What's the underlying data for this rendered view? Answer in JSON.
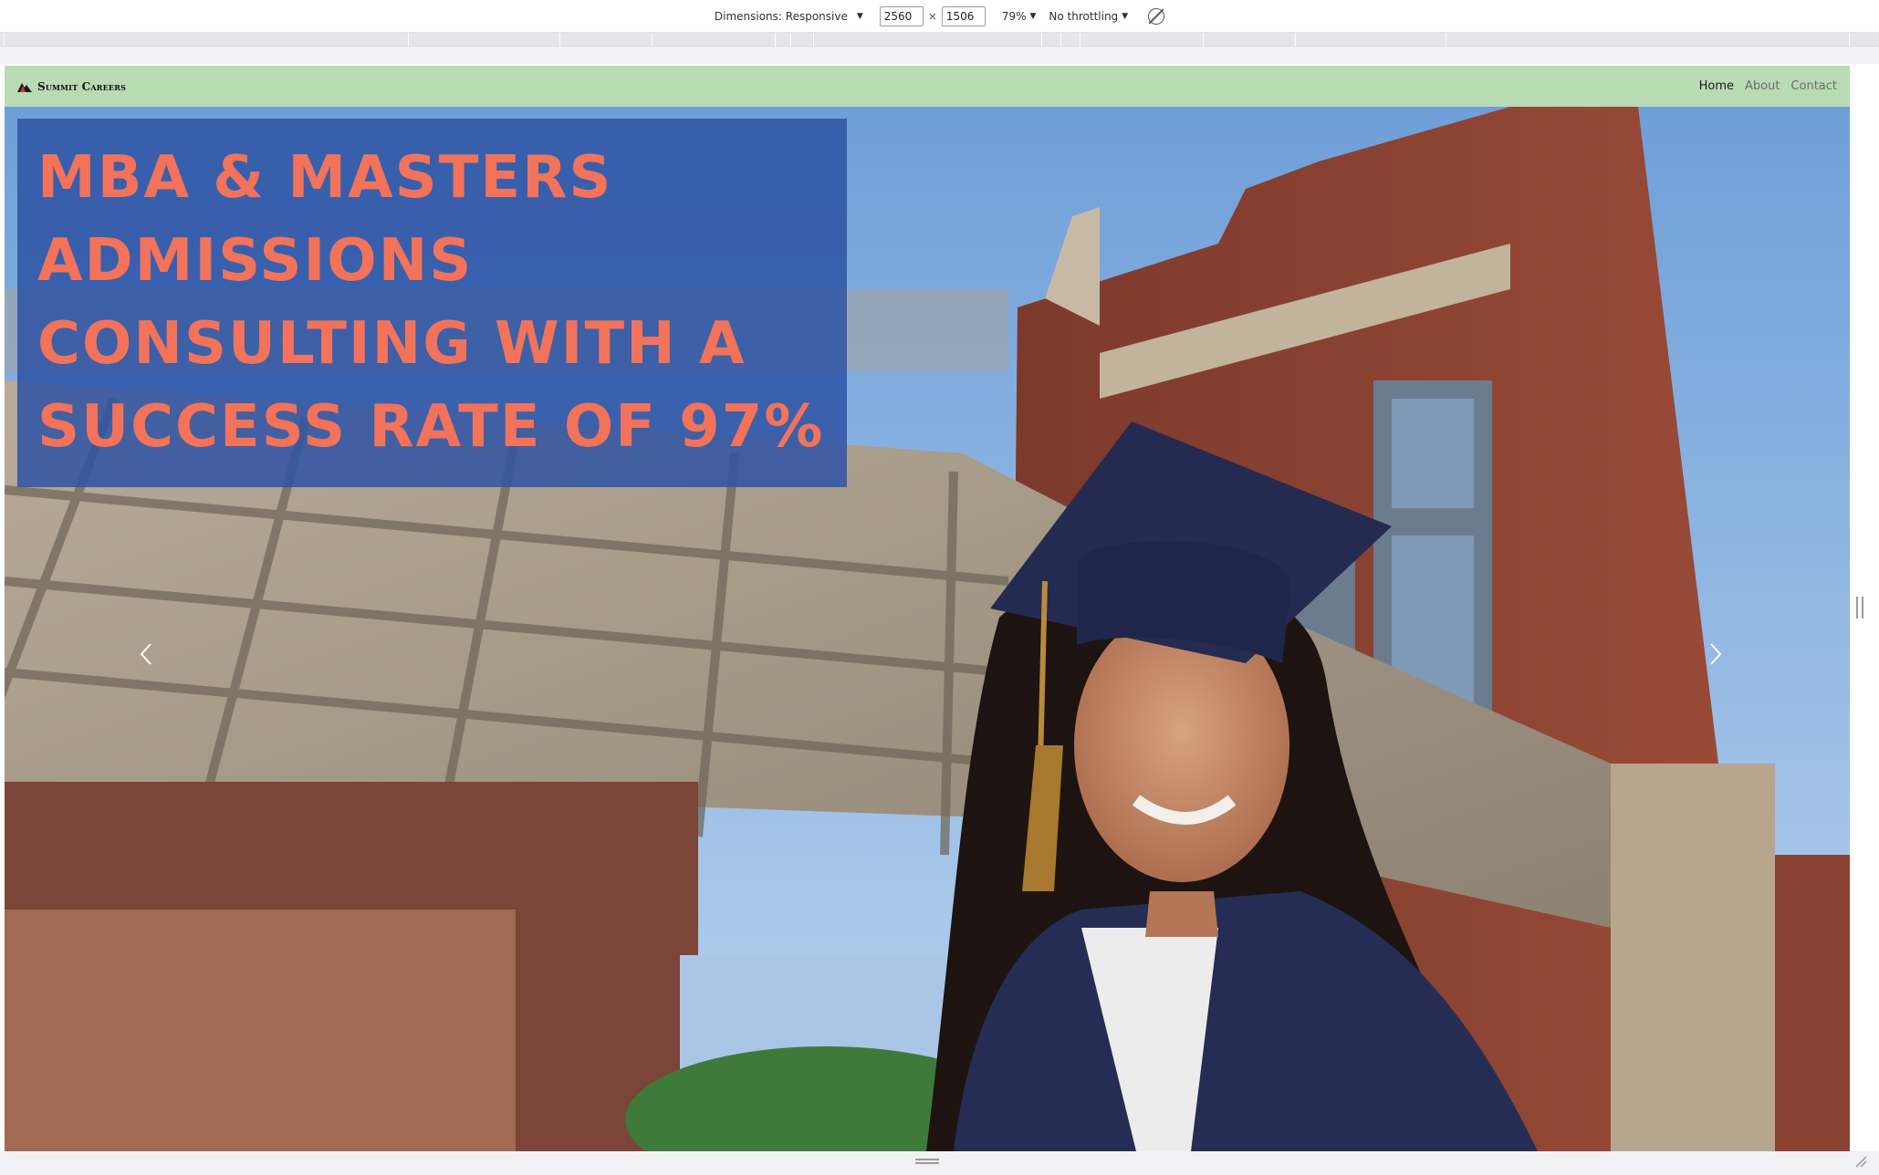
{
  "devtools": {
    "dimensions_label": "Dimensions: Responsive",
    "width_value": "2560",
    "height_value": "1506",
    "times_sign": "×",
    "zoom": "79%",
    "throttling": "No throttling",
    "caret": "▼"
  },
  "site": {
    "brand": "Summit Careers",
    "nav": {
      "home": "Home",
      "about": "About",
      "contact": "Contact"
    },
    "hero": {
      "headline": "MBA & Masters Admissions Consulting with a Success Rate of 97%"
    }
  },
  "colors": {
    "navbar_bg": "#b9dbb3",
    "headline_box": "#2e54a4",
    "headline_text": "#f2735a"
  },
  "icons": {
    "prev": "chevron-left-icon",
    "next": "chevron-right-icon",
    "rotate": "rotate-disabled-icon",
    "logo": "mountain-logo-icon"
  }
}
